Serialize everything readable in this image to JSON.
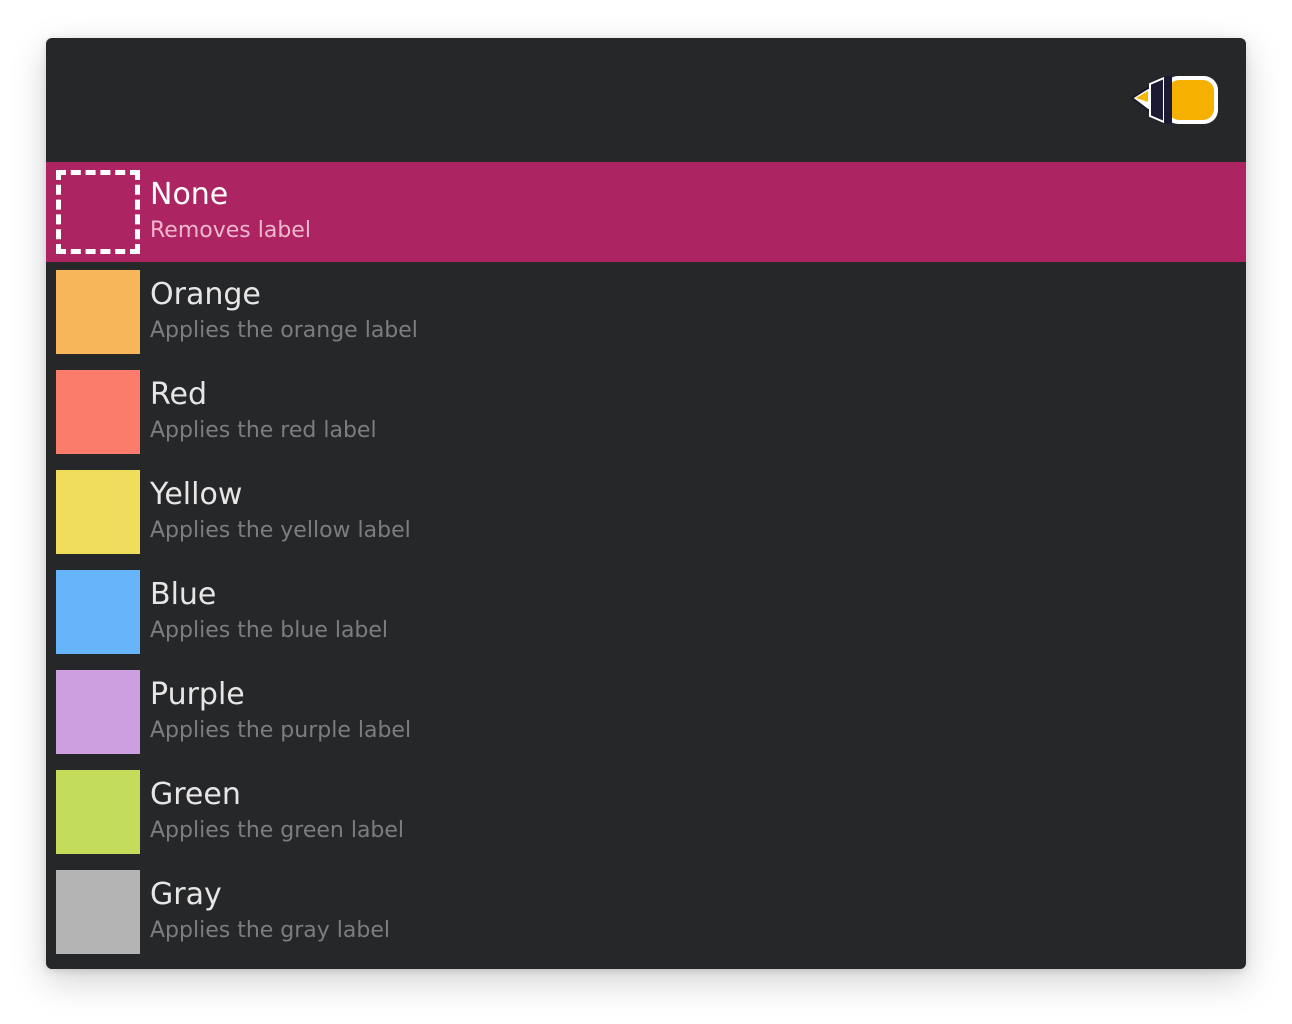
{
  "selected_index": 0,
  "items": [
    {
      "title": "None",
      "subtitle": "Removes label",
      "color": null
    },
    {
      "title": "Orange",
      "subtitle": "Applies the orange label",
      "color": "#f7b65a"
    },
    {
      "title": "Red",
      "subtitle": "Applies the red label",
      "color": "#fc7c6c"
    },
    {
      "title": "Yellow",
      "subtitle": "Applies the yellow label",
      "color": "#f0dd5c"
    },
    {
      "title": "Blue",
      "subtitle": "Applies the blue label",
      "color": "#68b4fb"
    },
    {
      "title": "Purple",
      "subtitle": "Applies the purple label",
      "color": "#cc9fe0"
    },
    {
      "title": "Green",
      "subtitle": "Applies the green label",
      "color": "#c3dc5b"
    },
    {
      "title": "Gray",
      "subtitle": "Applies the gray label",
      "color": "#b4b4b4"
    }
  ],
  "colors": {
    "background": "#262729",
    "selected_row": "#ac2461"
  },
  "app_icon": "highlighter-marker-icon"
}
